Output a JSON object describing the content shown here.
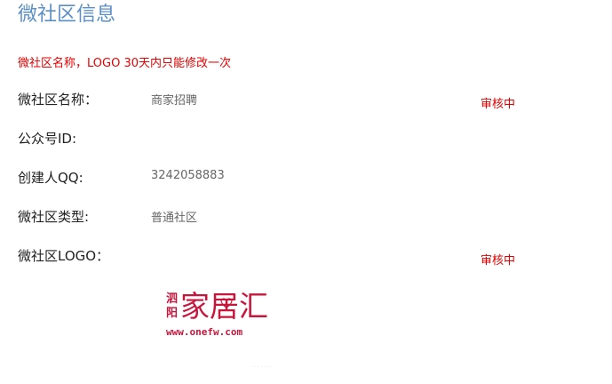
{
  "page": {
    "title": "微社区信息",
    "notice": "微社区名称，LOGO 30天内只能修改一次"
  },
  "fields": {
    "name": {
      "label": "微社区名称：",
      "value": "商家招聘",
      "status": "审核中"
    },
    "wechat": {
      "label": "公众号ID:"
    },
    "creator": {
      "label": "创建人QQ:",
      "value": "3242058883"
    },
    "type": {
      "label": "微社区类型:",
      "value": "普通社区"
    },
    "logo": {
      "label": "微社区LOGO：",
      "status": "审核中"
    }
  },
  "logo": {
    "side_text": "泗阳",
    "main_text": "家居汇",
    "url_text": "www.onefw.com",
    "color": "#c8153c"
  },
  "colors": {
    "title": "#5b8fc7",
    "notice": "#e60000",
    "status": "#e00000"
  }
}
